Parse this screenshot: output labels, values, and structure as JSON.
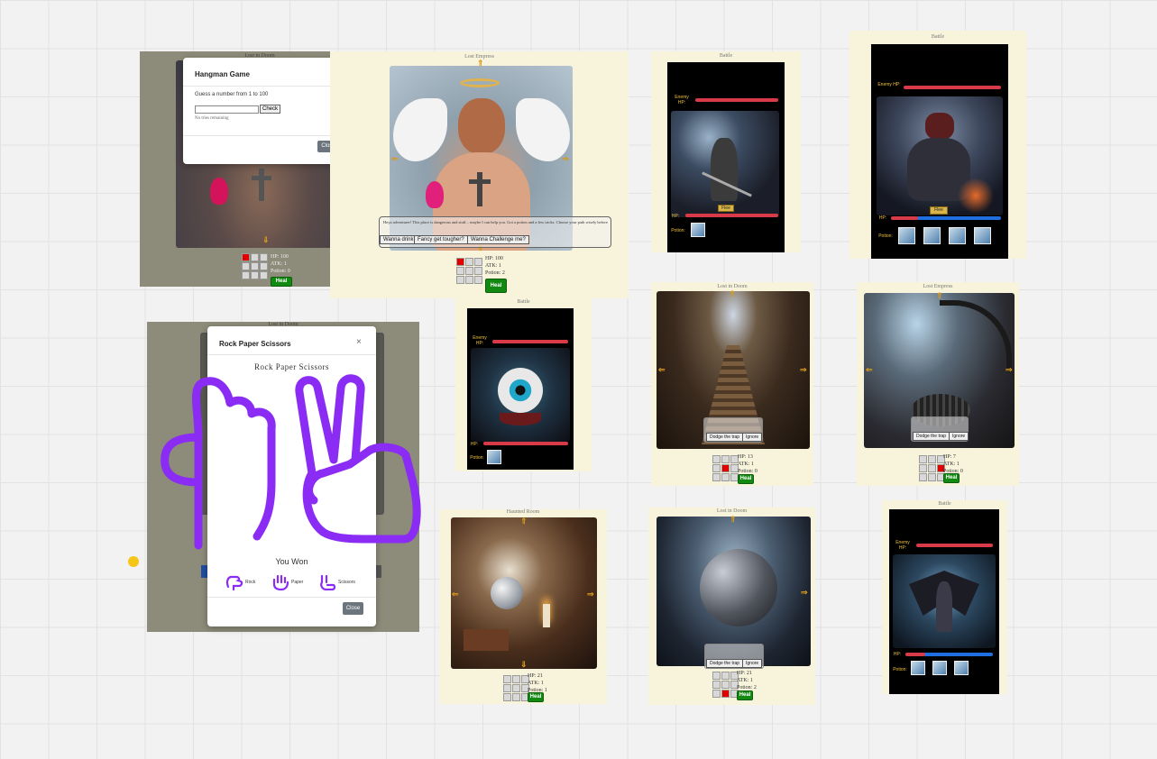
{
  "hangman": {
    "title": "Hangman Game",
    "close_x": "×",
    "prompt": "Guess a number from 1 to 100",
    "input_placeholder": "",
    "check_label": "Check",
    "attempts_label": "No tries remaining",
    "close_label": "Close",
    "room_title": "Lost in Doom",
    "hp": "HP: 100",
    "atk": "ATK: 1",
    "potion": "Potion: 0",
    "heal": "Heal"
  },
  "npc_panel": {
    "room_title": "Lost Empress",
    "dialog": "Heya adventurer! This place is dangerous and stuff... maybe I can help you. Got a potion and a few tricks. Choose your path wisely before it's too late...",
    "choices": [
      "Wanna drink some pints eh?",
      "Fancy get tougher?",
      "Wanna Challenge me?"
    ],
    "hp": "HP: 100",
    "atk": "ATK: 1",
    "potion": "Potion: 2",
    "heal": "Heal",
    "arrow_up": "⇑",
    "arrow_down": "⇓",
    "arrow_left": "⇐",
    "arrow_right": "⇒"
  },
  "battle_knight": {
    "room_title": "Battle",
    "enemy_hp_label": "Enemy HP:",
    "hp_label": "HP:",
    "potion_label": "Potion:",
    "flee": "Flee"
  },
  "battle_demon": {
    "room_title": "Battle",
    "enemy_hp_label": "Enemy HP:",
    "hp_label": "HP:",
    "potion_label": "Potion:",
    "flee": "Flee"
  },
  "rps": {
    "title": "Rock Paper Scissors",
    "heading": "Rock Paper Scissors",
    "result": "You Won",
    "options": [
      "Rock",
      "Paper",
      "Scissors"
    ],
    "close_label": "Close",
    "close_x": "×",
    "room_title": "Lost in Doom"
  },
  "battle_eye": {
    "room_title": "Battle",
    "enemy_hp_label": "Enemy HP:",
    "hp_label": "HP:",
    "potion_label": "Potion:"
  },
  "trap_hall": {
    "room_title": "Lost in Doom",
    "choices": [
      "Dodge the trap",
      "Ignore"
    ],
    "hp": "HP: 13",
    "atk": "ATK: 1",
    "potion": "Potion: 0",
    "heal": "Heal"
  },
  "trap_scythe": {
    "room_title": "Lost Empress",
    "choices": [
      "Dodge the trap",
      "Ignore"
    ],
    "hp": "HP: 7",
    "atk": "ATK: 1",
    "potion": "Potion: 0",
    "heal": "Heal"
  },
  "cobweb_room": {
    "room_title": "Haunted Room",
    "hp": "HP: 21",
    "atk": "ATK: 1",
    "potion": "Potion: 1",
    "heal": "Heal"
  },
  "boulder_room": {
    "room_title": "Lost in Doom",
    "choices": [
      "Dodge the trap",
      "Ignore"
    ],
    "hp": "HP: 21",
    "atk": "ATK: 1",
    "potion": "Potion: 2",
    "heal": "Heal"
  },
  "battle_vampire": {
    "room_title": "Battle",
    "enemy_hp_label": "Enemy HP:",
    "hp_label": "HP:",
    "potion_label": "Potion:"
  },
  "colors": {
    "accent": "#d89a1c",
    "enemy_hp": "#d93a48",
    "player_hp": "#1f6fe0",
    "heal": "#128a12",
    "rps_purple": "#8b2cf5",
    "marker": "#f5c518"
  }
}
